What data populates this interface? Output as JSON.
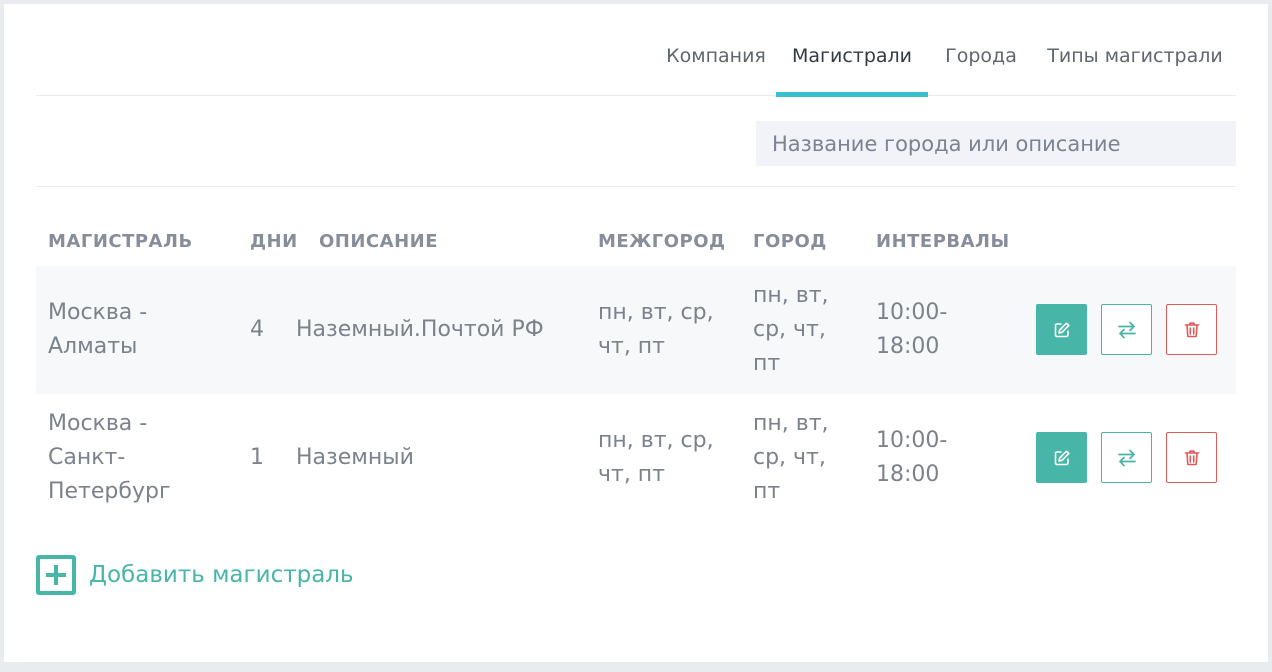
{
  "tabs": [
    {
      "label": "Компания",
      "active": false
    },
    {
      "label": "Магистрали",
      "active": true
    },
    {
      "label": "Города",
      "active": false
    },
    {
      "label": "Типы магистрали",
      "active": false
    }
  ],
  "search": {
    "placeholder": "Название города или описание",
    "value": ""
  },
  "table": {
    "headers": {
      "route": "МАГИСТРАЛЬ",
      "days": "ДНИ",
      "description": "ОПИСАНИЕ",
      "intercity": "МЕЖГОРОД",
      "city": "ГОРОД",
      "intervals": "ИНТЕРВАЛЫ"
    },
    "rows": [
      {
        "route": "Москва - Алматы",
        "days": "4",
        "description": "Наземный.Почтой РФ",
        "intercity": "пн, вт, ср, чт, пт",
        "city": "пн, вт, ср, чт, пт",
        "intervals": "10:00-18:00"
      },
      {
        "route": "Москва - Санкт-Петербург",
        "days": "1",
        "description": "Наземный",
        "intercity": "пн, вт, ср, чт, пт",
        "city": "пн, вт, ср, чт, пт",
        "intervals": "10:00-18:00"
      }
    ],
    "actions": {
      "edit_icon": "edit-icon",
      "swap_icon": "swap-icon",
      "delete_icon": "trash-icon"
    }
  },
  "add_button": {
    "label": "Добавить магистраль",
    "icon": "plus-square-icon"
  },
  "colors": {
    "accent": "#47b5a7",
    "tab_underline": "#37c1cf",
    "danger": "#e05a5a"
  }
}
